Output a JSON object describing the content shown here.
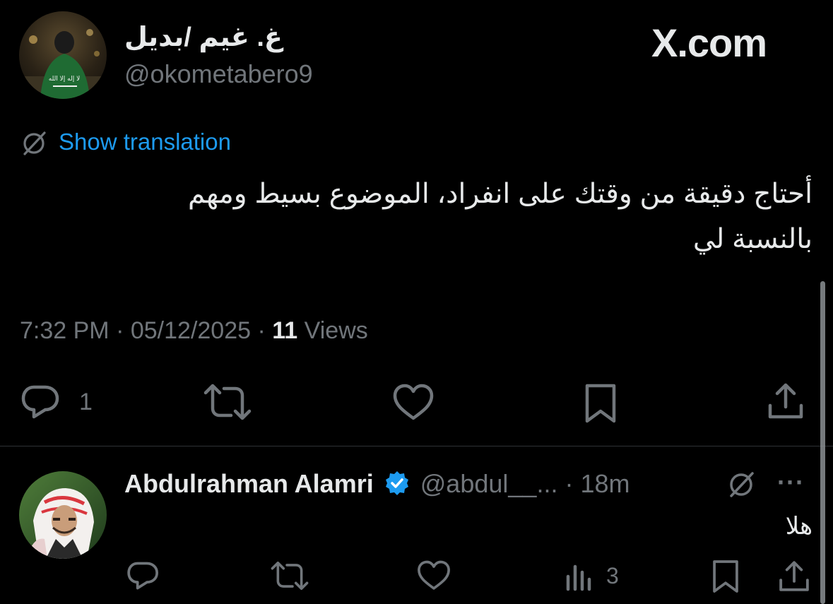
{
  "tweet": {
    "display_name": "غ. غيم /بديل",
    "handle": "@okometabero9",
    "brand": "X.com",
    "translate_label": "Show translation",
    "text_line1": "أحتاج دقيقة من وقتك على انفراد، الموضوع بسيط ومهم",
    "text_line2": "بالنسبة لي",
    "time": "7:32 PM",
    "sep1": "·",
    "date": "05/12/2025",
    "sep2": "·",
    "views_count": "11",
    "views_label": "Views",
    "reply_count": "1"
  },
  "reply": {
    "display_name": "Abdulrahman Alamri",
    "handle": "@abdul__...",
    "sep": "·",
    "age": "18m",
    "more": "···",
    "text": "هلا",
    "views_count": "3"
  },
  "colors": {
    "background": "#000000",
    "text": "#e7e9ea",
    "muted": "#71767b",
    "link": "#1d9bf0",
    "verified": "#1d9bf0",
    "divider": "#2f3336"
  }
}
